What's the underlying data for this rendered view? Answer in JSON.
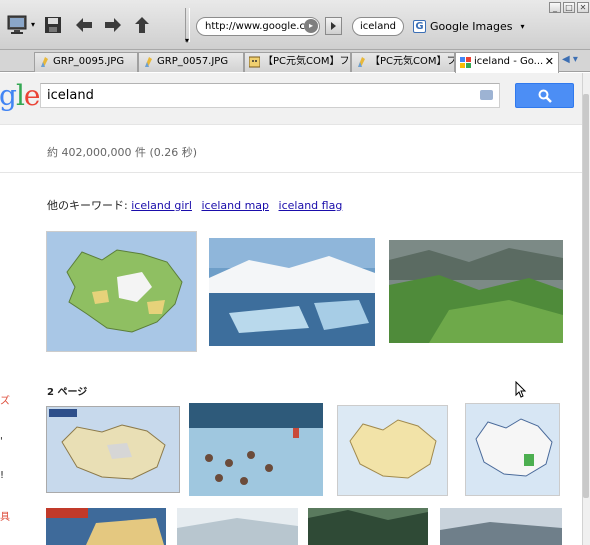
{
  "browser": {
    "url": "http://www.google.con",
    "search_box_value": "iceland",
    "search_engine": "Google Images",
    "tabs": [
      {
        "label": "GRP_0095.JPG",
        "icon": "image-icon"
      },
      {
        "label": "GRP_0057.JPG",
        "icon": "image-icon"
      },
      {
        "label": "【PC元気COM】フ...",
        "icon": "site-icon"
      },
      {
        "label": "【PC元気COM】フ...",
        "icon": "image-icon"
      },
      {
        "label": "iceland - Go...",
        "icon": "google-icon",
        "active": true
      }
    ]
  },
  "google": {
    "logo_text": "gle",
    "query": "iceland",
    "stats": "約 402,000,000 件 (0.26 秒)",
    "related_label": "他のキーワード:",
    "related": [
      "iceland girl",
      "iceland map",
      "iceland flag"
    ],
    "page2_label": "2 ページ",
    "side_fragments": [
      "ズ",
      "'",
      "!",
      "具"
    ]
  },
  "colors": {
    "accent": "#4c8ef5",
    "link": "#1a0dab",
    "side": "#dd4b39"
  }
}
